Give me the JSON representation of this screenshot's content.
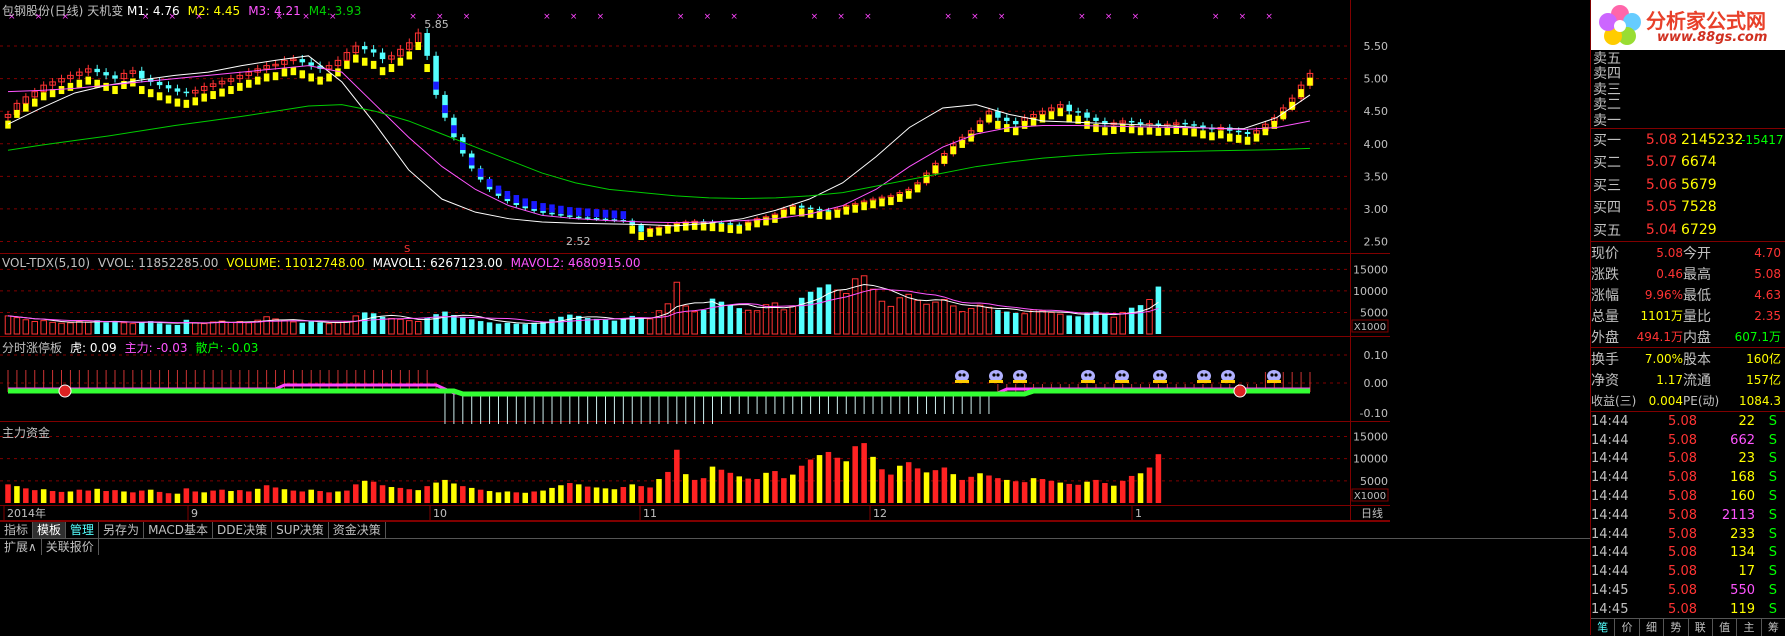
{
  "main_title": "包钢股份(日线)",
  "indicator_name": "天机变",
  "ma_labels": [
    {
      "text": "M1: 4.76",
      "color": "#ffffff"
    },
    {
      "text": "M2: 4.45",
      "color": "#ffff00"
    },
    {
      "text": "M3: 4.21",
      "color": "#ff55ff"
    },
    {
      "text": "M4: 3.93",
      "color": "#00cc00"
    }
  ],
  "price_axis": [
    "5.50",
    "5.00",
    "4.50",
    "4.00",
    "3.50",
    "3.00",
    "2.50"
  ],
  "high_label": "5.85",
  "low_label": "2.52",
  "marker_s": "S",
  "vol_header": [
    {
      "text": "VOL-TDX(5,10)",
      "color": "#c0c0c0"
    },
    {
      "text": "VVOL: 11852285.00",
      "color": "#c0c0c0"
    },
    {
      "text": "VOLUME: 11012748.00",
      "color": "#ffff00"
    },
    {
      "text": "MAVOL1: 6267123.00",
      "color": "#ffffff"
    },
    {
      "text": "MAVOL2: 4680915.00",
      "color": "#ff55ff"
    }
  ],
  "vol_axis": [
    "15000",
    "10000",
    "5000"
  ],
  "vol_unit": "X1000",
  "ind_header": [
    {
      "text": "分时涨停板",
      "color": "#c0c0c0"
    },
    {
      "text": "虎: 0.09",
      "color": "#ffffff"
    },
    {
      "text": "主力: -0.03",
      "color": "#ff55ff"
    },
    {
      "text": "散户: -0.03",
      "color": "#00ff00"
    }
  ],
  "ind_axis": [
    "0.10",
    "0.00",
    "-0.10"
  ],
  "flow_header": "主力资金",
  "flow_axis": [
    "15000",
    "10000",
    "5000"
  ],
  "flow_unit": "X1000",
  "date_labels": [
    {
      "text": "2014年",
      "color": "#c0c0c0"
    },
    {
      "text": "9",
      "color": "#c0c0c0"
    },
    {
      "text": "10",
      "color": "#c0c0c0"
    },
    {
      "text": "11",
      "color": "#c0c0c0"
    },
    {
      "text": "12",
      "color": "#c0c0c0"
    },
    {
      "text": "1",
      "color": "#c0c0c0"
    }
  ],
  "period_label": "日线",
  "toolbar_buttons": [
    "指标",
    "模板",
    "管理",
    "另存为",
    "MACD基本",
    "DDE决策",
    "SUP决策",
    "资金决策"
  ],
  "bottom_buttons": [
    "扩展∧",
    "关联报价"
  ],
  "logo_text": "分析家公式网",
  "logo_url": "www.88gs.com",
  "sell_rows": [
    {
      "label": "卖五",
      "price": "",
      "vol": ""
    },
    {
      "label": "卖四",
      "price": "",
      "vol": ""
    },
    {
      "label": "卖三",
      "price": "",
      "vol": ""
    },
    {
      "label": "卖二",
      "price": "",
      "vol": ""
    },
    {
      "label": "卖一",
      "price": "",
      "vol": ""
    }
  ],
  "buy_rows": [
    {
      "label": "买一",
      "price": "5.08",
      "vol": "2145232",
      "delta": "-15417"
    },
    {
      "label": "买二",
      "price": "5.07",
      "vol": "6674",
      "delta": ""
    },
    {
      "label": "买三",
      "price": "5.06",
      "vol": "5679",
      "delta": ""
    },
    {
      "label": "买四",
      "price": "5.05",
      "vol": "7528",
      "delta": ""
    },
    {
      "label": "买五",
      "price": "5.04",
      "vol": "6729",
      "delta": ""
    }
  ],
  "quote_rows": [
    {
      "l1": "现价",
      "v1": "5.08",
      "c1": "#ff3333",
      "l2": "今开",
      "v2": "4.70",
      "c2": "#ff3333"
    },
    {
      "l1": "涨跌",
      "v1": "0.46",
      "c1": "#ff3333",
      "l2": "最高",
      "v2": "5.08",
      "c2": "#ff3333"
    },
    {
      "l1": "涨幅",
      "v1": "9.96%",
      "c1": "#ff3333",
      "l2": "最低",
      "v2": "4.63",
      "c2": "#ff3333"
    },
    {
      "l1": "总量",
      "v1": "1101万",
      "c1": "#ffff00",
      "l2": "量比",
      "v2": "2.35",
      "c2": "#ff3333"
    },
    {
      "l1": "外盘",
      "v1": "494.1万",
      "c1": "#ff3333",
      "l2": "内盘",
      "v2": "607.1万",
      "c2": "#00ff00"
    },
    {
      "l1": "换手",
      "v1": "7.00%",
      "c1": "#ffff00",
      "l2": "股本",
      "v2": "160亿",
      "c2": "#ffff00"
    },
    {
      "l1": "净资",
      "v1": "1.17",
      "c1": "#ffff00",
      "l2": "流通",
      "v2": "157亿",
      "c2": "#ffff00"
    },
    {
      "l1": "收益(三)",
      "v1": "0.004",
      "c1": "#ffff00",
      "l2": "PE(动)",
      "v2": "1084.3",
      "c2": "#ffff00"
    }
  ],
  "ticks": [
    {
      "t": "14:44",
      "p": "5.08",
      "v": "22",
      "vc": "#ffff00",
      "s": "S"
    },
    {
      "t": "14:44",
      "p": "5.08",
      "v": "662",
      "vc": "#ff55ff",
      "s": "S"
    },
    {
      "t": "14:44",
      "p": "5.08",
      "v": "23",
      "vc": "#ffff00",
      "s": "S"
    },
    {
      "t": "14:44",
      "p": "5.08",
      "v": "168",
      "vc": "#ffff00",
      "s": "S"
    },
    {
      "t": "14:44",
      "p": "5.08",
      "v": "160",
      "vc": "#ffff00",
      "s": "S"
    },
    {
      "t": "14:44",
      "p": "5.08",
      "v": "2113",
      "vc": "#ff55ff",
      "s": "S"
    },
    {
      "t": "14:44",
      "p": "5.08",
      "v": "233",
      "vc": "#ffff00",
      "s": "S"
    },
    {
      "t": "14:44",
      "p": "5.08",
      "v": "134",
      "vc": "#ffff00",
      "s": "S"
    },
    {
      "t": "14:44",
      "p": "5.08",
      "v": "17",
      "vc": "#ffff00",
      "s": "S"
    },
    {
      "t": "14:45",
      "p": "5.08",
      "v": "550",
      "vc": "#ff55ff",
      "s": "S"
    },
    {
      "t": "14:45",
      "p": "5.08",
      "v": "119",
      "vc": "#ffff00",
      "s": "S"
    }
  ],
  "side_tabs": [
    "笔",
    "价",
    "细",
    "势",
    "联",
    "值",
    "主",
    "筹"
  ],
  "chart_data": {
    "type": "candlestick",
    "y_range": [
      2.4,
      5.9
    ],
    "close": [
      4.45,
      4.62,
      4.72,
      4.8,
      4.9,
      4.95,
      5.0,
      5.05,
      5.1,
      5.15,
      5.1,
      5.05,
      5.0,
      5.08,
      5.12,
      5.0,
      4.95,
      4.9,
      4.85,
      4.8,
      4.78,
      4.82,
      4.88,
      4.92,
      4.96,
      5.0,
      5.05,
      5.1,
      5.15,
      5.2,
      5.22,
      5.28,
      5.3,
      5.25,
      5.2,
      5.15,
      5.2,
      5.28,
      5.4,
      5.5,
      5.45,
      5.4,
      5.3,
      5.35,
      5.45,
      5.55,
      5.7,
      5.35,
      4.75,
      4.4,
      4.1,
      3.85,
      3.62,
      3.45,
      3.3,
      3.2,
      3.12,
      3.06,
      3.01,
      2.97,
      2.94,
      2.92,
      2.9,
      2.88,
      2.87,
      2.86,
      2.85,
      2.84,
      2.83,
      2.82,
      2.75,
      2.65,
      2.7,
      2.72,
      2.75,
      2.78,
      2.8,
      2.81,
      2.8,
      2.79,
      2.78,
      2.76,
      2.75,
      2.8,
      2.85,
      2.88,
      2.92,
      3.0,
      3.05,
      3.02,
      3.0,
      2.98,
      2.97,
      3.0,
      3.05,
      3.08,
      3.12,
      3.15,
      3.18,
      3.2,
      3.25,
      3.3,
      3.4,
      3.55,
      3.7,
      3.85,
      4.0,
      4.1,
      4.2,
      4.35,
      4.5,
      4.4,
      4.35,
      4.3,
      4.4,
      4.45,
      4.5,
      4.55,
      4.6,
      4.5,
      4.48,
      4.4,
      4.35,
      4.3,
      4.32,
      4.35,
      4.33,
      4.3,
      4.31,
      4.29,
      4.3,
      4.32,
      4.3,
      4.28,
      4.25,
      4.22,
      4.25,
      4.2,
      4.18,
      4.15,
      4.2,
      4.3,
      4.4,
      4.55,
      4.7,
      4.9,
      5.08
    ],
    "ma": [
      {
        "name": "M1",
        "values": [
          4.3,
          4.55,
          4.78,
          4.9,
          4.98,
          5.05,
          5.1,
          5.2,
          5.28,
          5.35,
          4.95,
          4.3,
          3.6,
          3.15,
          2.95,
          2.85,
          2.8,
          2.78,
          2.77,
          2.76,
          2.74,
          2.78,
          2.85,
          2.98,
          3.15,
          3.4,
          3.8,
          4.25,
          4.55,
          4.6,
          4.45,
          4.35,
          4.33,
          4.31,
          4.29,
          4.27,
          4.24,
          4.23,
          4.4,
          4.75
        ],
        "color": "#ffffff"
      },
      {
        "name": "M3",
        "values": [
          4.8,
          4.82,
          4.85,
          4.9,
          4.95,
          5.0,
          5.05,
          5.1,
          5.15,
          5.2,
          5.1,
          4.6,
          4.1,
          3.65,
          3.3,
          3.05,
          2.9,
          2.85,
          2.82,
          2.8,
          2.79,
          2.8,
          2.82,
          2.85,
          2.92,
          3.05,
          3.3,
          3.65,
          3.95,
          4.15,
          4.25,
          4.28,
          4.28,
          4.27,
          4.26,
          4.25,
          4.24,
          4.22,
          4.25,
          4.35
        ],
        "color": "#ff55ff"
      },
      {
        "name": "M4",
        "values": [
          3.9,
          3.98,
          4.05,
          4.12,
          4.2,
          4.28,
          4.35,
          4.42,
          4.5,
          4.58,
          4.6,
          4.5,
          4.35,
          4.15,
          3.95,
          3.75,
          3.55,
          3.4,
          3.3,
          3.25,
          3.2,
          3.17,
          3.16,
          3.17,
          3.2,
          3.25,
          3.35,
          3.45,
          3.55,
          3.65,
          3.72,
          3.78,
          3.82,
          3.85,
          3.87,
          3.88,
          3.89,
          3.9,
          3.91,
          3.93
        ],
        "color": "#00cc00"
      }
    ],
    "volume": [
      4200,
      3800,
      3300,
      2900,
      3100,
      2700,
      2500,
      2600,
      3000,
      2800,
      3200,
      2700,
      2900,
      2600,
      2400,
      2800,
      3000,
      2500,
      2200,
      2100,
      3300,
      2600,
      2400,
      2800,
      3000,
      2700,
      2900,
      2600,
      3200,
      4000,
      3500,
      3100,
      2800,
      2600,
      3000,
      2700,
      2400,
      2600,
      2800,
      4200,
      5000,
      4800,
      4000,
      3600,
      3400,
      3100,
      2900,
      3800,
      4600,
      5200,
      4400,
      3800,
      3400,
      3000,
      2700,
      2400,
      2600,
      2400,
      2300,
      2600,
      2800,
      3400,
      4000,
      4500,
      4200,
      3700,
      3500,
      3300,
      3100,
      3600,
      4200,
      3800,
      3500,
      5400,
      7000,
      12000,
      6500,
      5200,
      5600,
      8200,
      7500,
      6800,
      6000,
      5500,
      5400,
      6800,
      7200,
      5600,
      6400,
      8400,
      9800,
      10800,
      11500,
      10200,
      9400,
      12800,
      13500,
      10400,
      7600,
      6400,
      8400,
      9200,
      7800,
      6900,
      7400,
      8000,
      6500,
      5200,
      5900,
      6700,
      6200,
      5600,
      5200,
      4900,
      4700,
      5600,
      5400,
      5000,
      4600,
      4300,
      4100,
      4800,
      5200,
      4500,
      3900,
      5000,
      6100,
      6700,
      8000,
      11000
    ]
  }
}
